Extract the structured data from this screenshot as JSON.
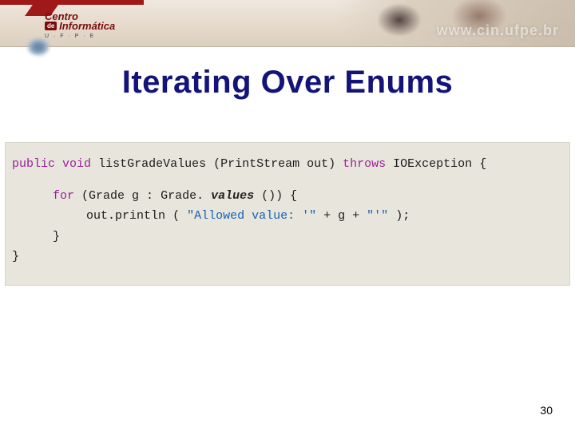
{
  "header": {
    "logo_line1_a": "Centro",
    "logo_line2_de": "de",
    "logo_line2_b": "Informática",
    "logo_ufpe": "U · F · P · E",
    "url": "www.cin.ufpe.br"
  },
  "slide": {
    "title": "Iterating Over Enums",
    "page_number": "30"
  },
  "code": {
    "kw_public": "public",
    "kw_void": "void",
    "method_name": "listGradeValues",
    "sig_params_open": "(PrintStream out) ",
    "kw_throws": "throws",
    "sig_tail": " IOException {",
    "kw_for": "for",
    "for_head": " (Grade g : Grade.",
    "values_call": "values",
    "for_tail": "()) {",
    "print_call": "out.println",
    "print_open": "(",
    "str1": "\"Allowed value: '\"",
    "plus1": " + g + ",
    "str2": "\"'\"",
    "print_close": ");",
    "brace_inner": "}",
    "brace_outer": "}"
  }
}
